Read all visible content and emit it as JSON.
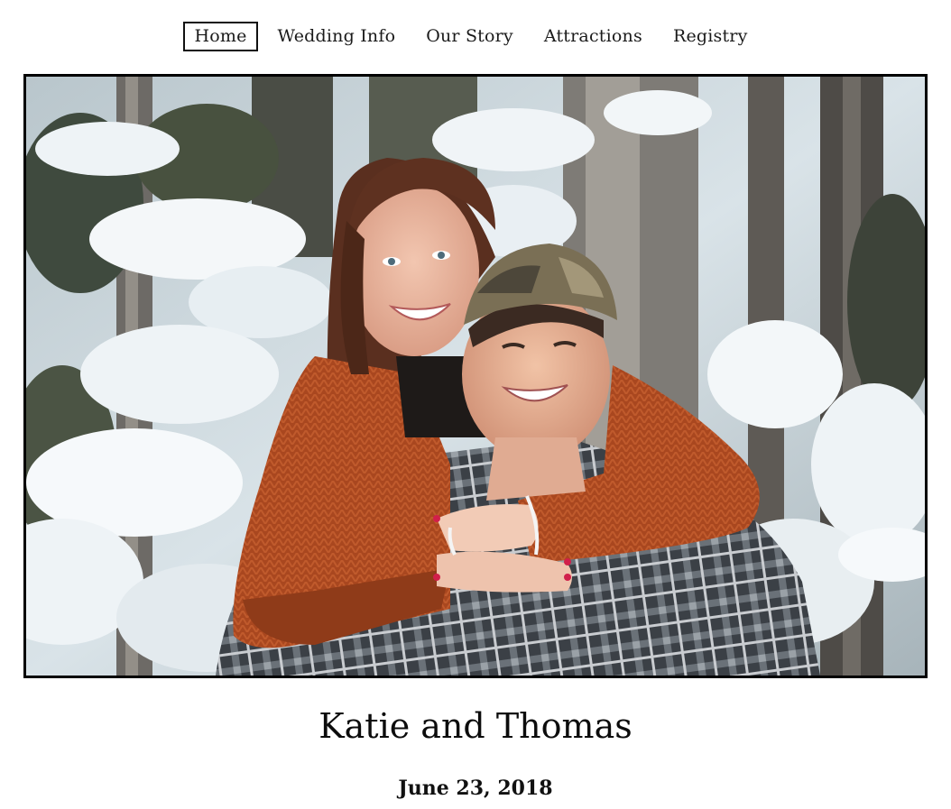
{
  "nav": {
    "items": [
      {
        "label": "Home",
        "active": true
      },
      {
        "label": "Wedding Info",
        "active": false
      },
      {
        "label": "Our Story",
        "active": false
      },
      {
        "label": "Attractions",
        "active": false
      },
      {
        "label": "Registry",
        "active": false
      }
    ]
  },
  "hero": {
    "alt": "Couple smiling in snowy forest"
  },
  "couple_names": "Katie and Thomas",
  "wedding_date": "June 23, 2018",
  "colors": {
    "border": "#000000",
    "text": "#111111",
    "background": "#ffffff"
  }
}
